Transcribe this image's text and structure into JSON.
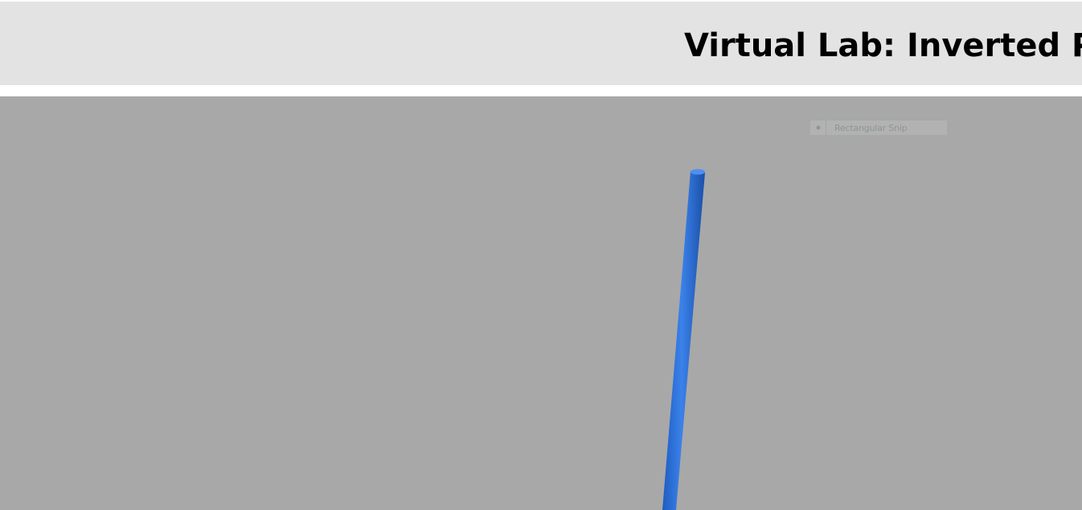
{
  "header": {
    "title": "Virtual Lab: Inverted P"
  },
  "snip_overlay": {
    "label": "Rectangular Snip",
    "icon": "snip-mode-icon"
  },
  "scene": {
    "background_color": "#a8a8a8",
    "pendulum_rod_color": "#2f72d6",
    "objects": [
      "pendulum-rod"
    ]
  }
}
